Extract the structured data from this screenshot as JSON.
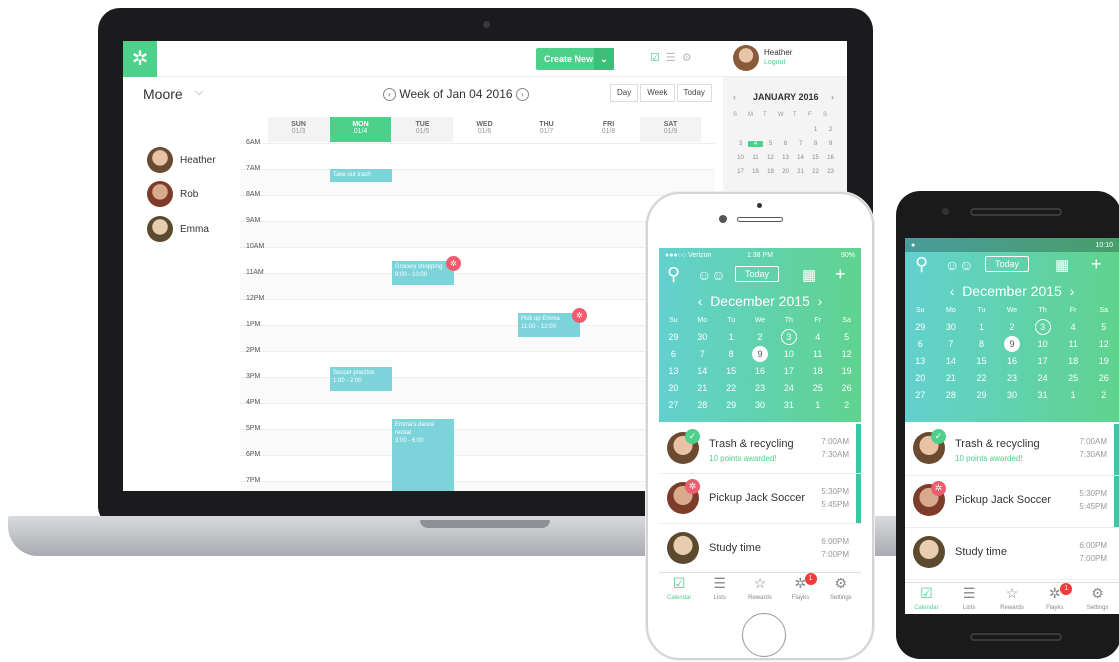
{
  "desktop": {
    "create_new": "Create New",
    "user": {
      "name": "Heather",
      "logout": "Logout"
    },
    "family": "Moore",
    "week_label": "Week of Jan 04 2016",
    "view_buttons": [
      "Day",
      "Week",
      "Today"
    ],
    "people": [
      "Heather",
      "Rob",
      "Emma"
    ],
    "days": [
      {
        "d": "SUN",
        "n": "01/3"
      },
      {
        "d": "MON",
        "n": "01/4"
      },
      {
        "d": "TUE",
        "n": "01/5"
      },
      {
        "d": "WED",
        "n": "01/6"
      },
      {
        "d": "THU",
        "n": "01/7"
      },
      {
        "d": "FRI",
        "n": "01/8"
      },
      {
        "d": "SAT",
        "n": "01/9"
      }
    ],
    "hours": [
      "6AM",
      "7AM",
      "8AM",
      "9AM",
      "10AM",
      "11AM",
      "12PM",
      "1PM",
      "2PM",
      "3PM",
      "4PM",
      "5PM",
      "6PM",
      "7PM"
    ],
    "events": [
      {
        "title": "Take out trash",
        "time": ""
      },
      {
        "title": "Grocery shopping",
        "time": "9:00 - 10:00"
      },
      {
        "title": "Pick up Emma",
        "time": "11:00 - 12:00"
      },
      {
        "title": "Soccer practice",
        "time": "1:00 - 2:00"
      },
      {
        "title": "Emma's dance recital",
        "time": "3:00 - 6:00"
      }
    ],
    "mini_cal": {
      "title": "JANUARY 2016",
      "dow": [
        "S",
        "M",
        "T",
        "W",
        "T",
        "F",
        "S"
      ],
      "rows": [
        [
          "",
          "",
          "",
          "",
          "",
          "1",
          "2"
        ],
        [
          "3",
          "4",
          "5",
          "6",
          "7",
          "8",
          "9"
        ],
        [
          "10",
          "11",
          "12",
          "13",
          "14",
          "15",
          "16"
        ],
        [
          "17",
          "18",
          "19",
          "20",
          "21",
          "22",
          "23"
        ]
      ]
    }
  },
  "iphone": {
    "carrier": "●●●○○ Verizon",
    "time": "1:38 PM",
    "battery": "90%"
  },
  "android": {
    "time": "10:10"
  },
  "phone_app": {
    "today_label": "Today",
    "month": "December 2015",
    "dow": [
      "Su",
      "Mo",
      "Tu",
      "We",
      "Th",
      "Fr",
      "Sa"
    ],
    "weeks": [
      [
        "29",
        "30",
        "1",
        "2",
        "3",
        "4",
        "5"
      ],
      [
        "6",
        "7",
        "8",
        "9",
        "10",
        "11",
        "12"
      ],
      [
        "13",
        "14",
        "15",
        "16",
        "17",
        "18",
        "19"
      ],
      [
        "20",
        "21",
        "22",
        "23",
        "24",
        "25",
        "26"
      ],
      [
        "27",
        "28",
        "29",
        "30",
        "31",
        "1",
        "2"
      ]
    ],
    "items": [
      {
        "title": "Trash & recycling",
        "sub": "10 points awarded!",
        "t1": "7:00AM",
        "t2": "7:30AM"
      },
      {
        "title": "Pickup Jack Soccer",
        "sub": "",
        "t1": "5:30PM",
        "t2": "5:45PM"
      },
      {
        "title": "Study time",
        "sub": "",
        "t1": "6:00PM",
        "t2": "7:00PM"
      }
    ],
    "tabs": [
      "Calendar",
      "Lists",
      "Rewards",
      "Flayks",
      "Settings"
    ],
    "flayks_badge": "1"
  },
  "colors": {
    "accent": "#4cd08a",
    "event": "#7dd3da",
    "badge": "#ef5c6e"
  }
}
